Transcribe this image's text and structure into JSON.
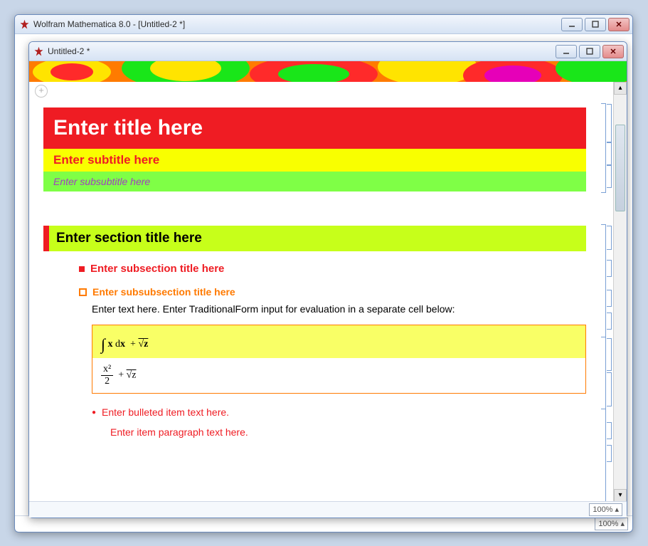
{
  "back_window": {
    "title": "Wolfram Mathematica 8.0 - [Untitled-2 *]",
    "zoom": "100%"
  },
  "front_window": {
    "title": "Untitled-2 *",
    "zoom": "100%"
  },
  "notebook": {
    "title": "Enter title here",
    "subtitle": "Enter subtitle here",
    "subsubtitle": "Enter subsubtitle here",
    "section": "Enter section title here",
    "subsection": "Enter subsection title here",
    "subsubsection": "Enter subsubsection title here",
    "body_text": "Enter text here. Enter TraditionalForm input for evaluation in a separate cell below:",
    "formula_input_display": "∫ x  dx + √z",
    "formula_parts": {
      "var": "x",
      "dprefix": "d",
      "dvar": "x",
      "root_arg": "z",
      "frac_num": "x²",
      "frac_den": "2"
    },
    "bulleted_item": "Enter bulleted item text here.",
    "item_paragraph": "Enter item paragraph text here."
  }
}
